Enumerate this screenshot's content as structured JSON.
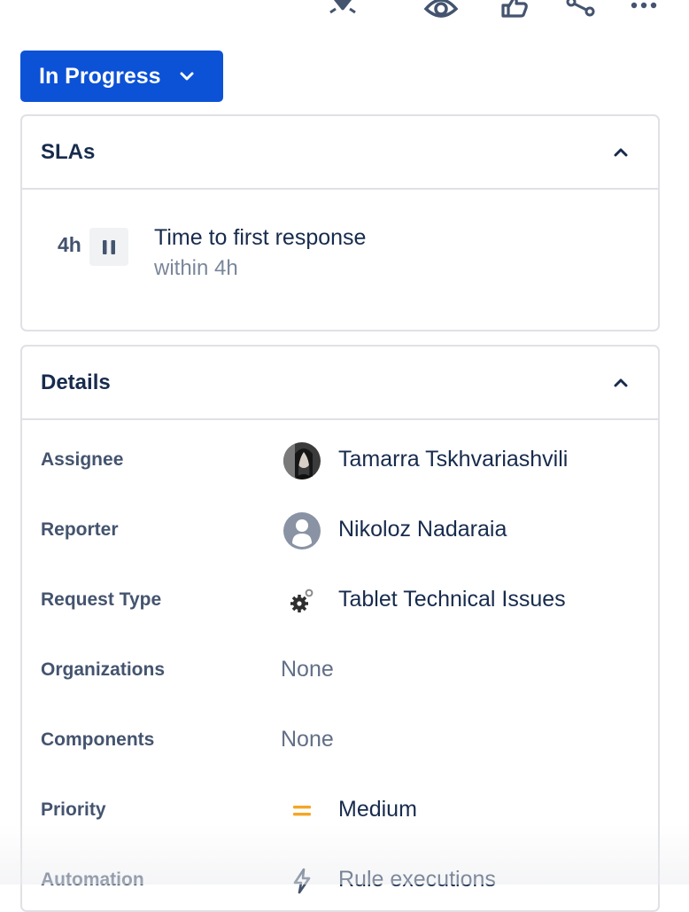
{
  "toolbar": {
    "icons": [
      "notification-icon",
      "watch-icon",
      "like-icon",
      "share-icon",
      "more-icon"
    ]
  },
  "status": {
    "label": "In Progress",
    "color": "#0c52d6"
  },
  "slas": {
    "title": "SLAs",
    "items": [
      {
        "time": "4h",
        "name": "Time to first response",
        "goal": "within 4h"
      }
    ]
  },
  "details": {
    "title": "Details",
    "fields": [
      {
        "label": "Assignee",
        "value": "Tamarra Tskhvariashvili",
        "icon": "user-photo-avatar"
      },
      {
        "label": "Reporter",
        "value": "Nikoloz Nadaraia",
        "icon": "default-user-avatar"
      },
      {
        "label": "Request Type",
        "value": "Tablet Technical Issues",
        "icon": "gears-icon"
      },
      {
        "label": "Organizations",
        "value": "None"
      },
      {
        "label": "Components",
        "value": "None"
      },
      {
        "label": "Priority",
        "value": "Medium",
        "icon": "priority-medium-icon",
        "color": "#f5a623"
      },
      {
        "label": "Automation",
        "value": "Rule executions",
        "icon": "lightning-icon"
      }
    ]
  }
}
